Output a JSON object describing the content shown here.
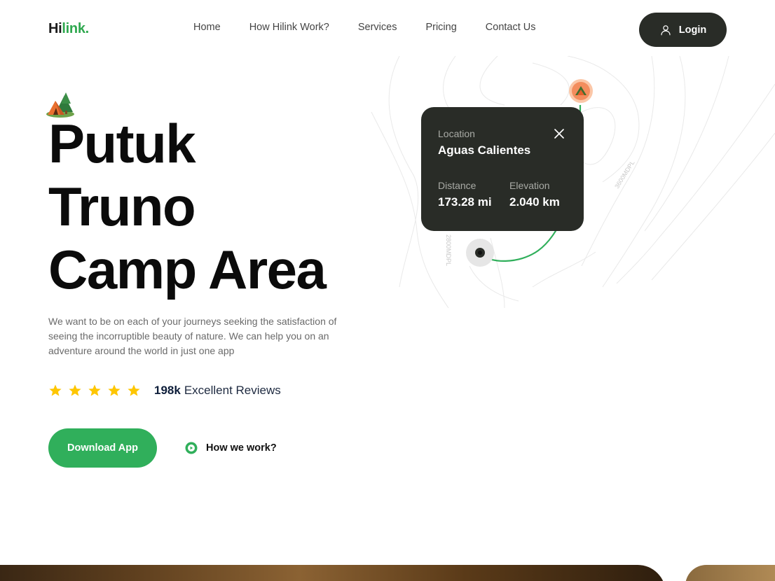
{
  "brand": {
    "part1": "Hi",
    "part2": "link.",
    "accent": "#30af5b",
    "dark": "#292c27"
  },
  "nav": {
    "links": [
      "Home",
      "How Hilink Work?",
      "Services",
      "Pricing",
      "Contact Us"
    ],
    "login_label": "Login",
    "login_icon": "user-icon"
  },
  "hero": {
    "title_line1": "Putuk",
    "title_line2": "Truno",
    "title_line3": "Camp Area",
    "description": "We want to be on each of your journeys seeking the satisfaction of seeing the incorruptible beauty of nature. We can help you on an adventure around the world in just one app",
    "rating_stars": 5,
    "reviews_count": "198k",
    "reviews_label": "Excellent Reviews",
    "download_label": "Download App",
    "how_label": "How we work?",
    "star_color": "#fec601"
  },
  "map": {
    "contour_label_1": "3600MDPL",
    "contour_label_2": "2800MDPL"
  },
  "location_card": {
    "location_label": "Location",
    "location_value": "Aguas Calientes",
    "distance_label": "Distance",
    "distance_value": "173.28 mi",
    "elevation_label": "Elevation",
    "elevation_value": "2.040 km"
  }
}
